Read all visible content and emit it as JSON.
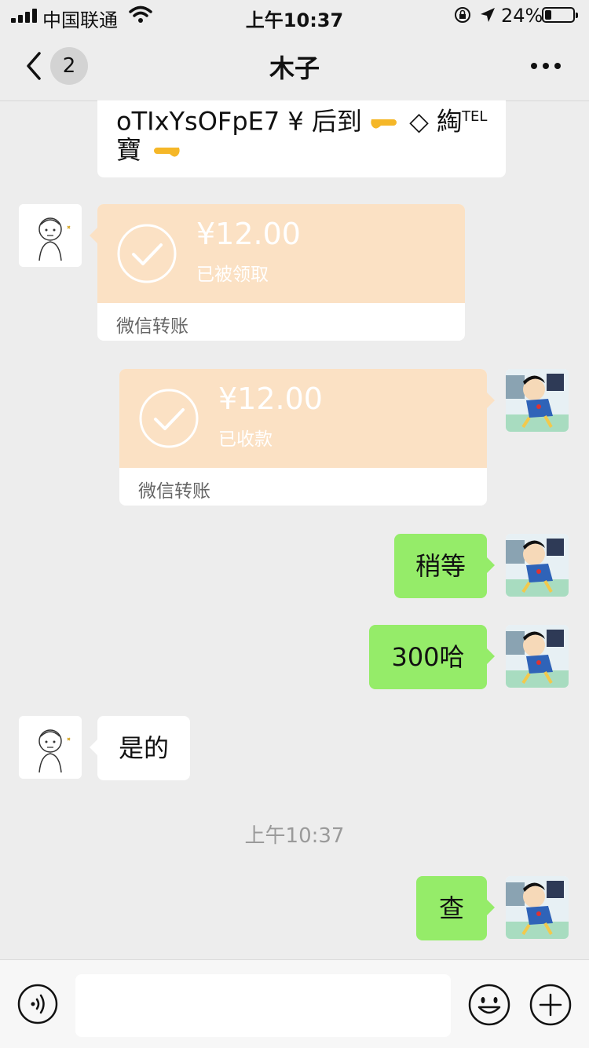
{
  "status_bar": {
    "carrier": "中国联通",
    "time": "上午10:37",
    "battery_pct": "24%",
    "battery_level": 0.24
  },
  "nav": {
    "unread_count": "2",
    "title": "木子"
  },
  "messages": {
    "partial_line1": "oTIxYsOFpE7 ¥ 后到",
    "partial_symbol": "◇ 綯",
    "partial_tel": "TEL",
    "partial_line2": "寶",
    "transfer_received": {
      "amount": "¥12.00",
      "status": "已被领取",
      "footer": "微信转账"
    },
    "transfer_sent": {
      "amount": "¥12.00",
      "status": "已收款",
      "footer": "微信转账"
    },
    "msg_wait": "稍等",
    "msg_300": "300哈",
    "msg_yes": "是的",
    "msg_check": "查"
  },
  "timestamp": "上午10:37",
  "colors": {
    "green_bubble": "#95ec69",
    "transfer_orange": "#fbe1c4",
    "background": "#ededed"
  },
  "input": {
    "value": ""
  }
}
